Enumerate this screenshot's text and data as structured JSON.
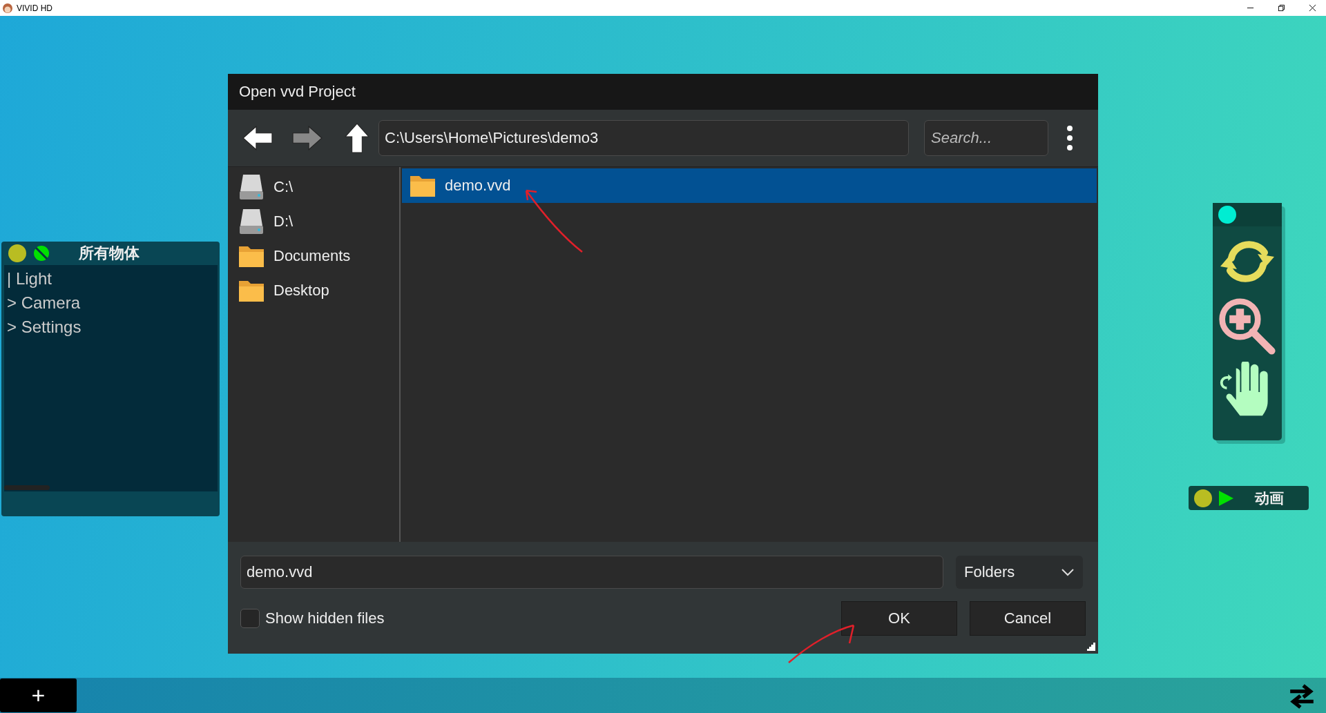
{
  "app": {
    "title": "VIVID HD"
  },
  "objects_panel": {
    "title": "所有物体",
    "items": [
      {
        "label": "| Light"
      },
      {
        "label": "> Camera"
      },
      {
        "label": "> Settings"
      }
    ]
  },
  "dialog": {
    "title": "Open vvd Project",
    "nav": [
      {
        "kind": "back",
        "disabled": false
      },
      {
        "kind": "forward",
        "disabled": true
      },
      {
        "kind": "up",
        "disabled": false
      }
    ],
    "path": "C:\\Users\\Home\\Pictures\\demo3",
    "search": {
      "placeholder": "Search..."
    },
    "places": [
      {
        "label": "C:\\",
        "kind": "drive"
      },
      {
        "label": "D:\\",
        "kind": "drive"
      },
      {
        "label": "Documents",
        "kind": "folder"
      },
      {
        "label": "Desktop",
        "kind": "folder"
      }
    ],
    "files": [
      {
        "name": "demo.vvd",
        "selected": true
      }
    ],
    "filename": "demo.vvd",
    "filter": "Folders",
    "show_hidden": {
      "label": "Show hidden files",
      "checked": false
    },
    "buttons": [
      "OK",
      "Cancel"
    ]
  },
  "animation_panel": {
    "label": "动画"
  },
  "bottom_bar": {
    "add_label": "+"
  }
}
